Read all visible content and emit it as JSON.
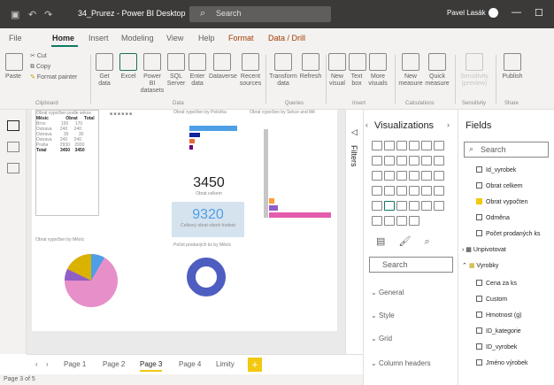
{
  "titlebar": {
    "title": "34_Prurez - Power BI Desktop",
    "search": "Search",
    "user": "Pavel Lasák"
  },
  "ribbon_tabs": [
    "File",
    "Home",
    "Insert",
    "Modeling",
    "View",
    "Help",
    "Format",
    "Data / Drill"
  ],
  "ribbon": {
    "clipboard": {
      "paste": "Paste",
      "cut": "Cut",
      "copy": "Copy",
      "format_painter": "Format painter",
      "label": "Clipboard"
    },
    "data": {
      "get_data": "Get data",
      "excel": "Excel",
      "power_bi": "Power BI datasets",
      "sql": "SQL Server",
      "enter": "Enter data",
      "dataverse": "Dataverse",
      "recent": "Recent sources",
      "label": "Data"
    },
    "queries": {
      "transform": "Transform data",
      "refresh": "Refresh",
      "label": "Queries"
    },
    "insert": {
      "new_visual": "New visual",
      "text_box": "Text box",
      "more_visuals": "More visuals",
      "label": "Insert"
    },
    "calculations": {
      "new_measure": "New measure",
      "quick_measure": "Quick measure",
      "label": "Calculations"
    },
    "sensitivity": {
      "sensitivity": "Sensitivity (preview)",
      "label": "Sensitivity"
    },
    "share": {
      "publish": "Publish",
      "label": "Share"
    }
  },
  "report": {
    "card1_value": "3450",
    "card1_label": "Obrat celkem",
    "card2_value": "9320",
    "card2_label": "Celkový obrat všech hodnot",
    "bar_title": "Obrat vypočten by Položka",
    "stack_title": "Obrat vypočten by Sekce and Mě",
    "pie_title": "Obrat vypočten by Měsíc",
    "donut_title": "Počet prodaných ks by Měsíc",
    "table_title": "Obrat vypočten podle sekce",
    "table_headers": [
      "Měsíc",
      "Obrat",
      "Total"
    ],
    "table_rows": [
      [
        "Brno",
        "150",
        "170"
      ],
      [
        "Ostrava",
        "240",
        "240"
      ],
      [
        "Ostrava",
        "30",
        "30"
      ],
      [
        "Ostrava",
        "240",
        "240"
      ],
      [
        "Praha",
        "2930",
        "2930"
      ],
      [
        "Total",
        "3450",
        "3450"
      ]
    ]
  },
  "filters_label": "Filters",
  "visualizations": {
    "title": "Visualizations",
    "search": "Search",
    "sections": [
      "General",
      "Style",
      "Grid",
      "Column headers"
    ]
  },
  "fields": {
    "title": "Fields",
    "search": "Search",
    "items": [
      {
        "label": "Id_vyrobek",
        "check": false
      },
      {
        "label": "Obrat celkem",
        "check": false
      },
      {
        "label": "Obrat vypočten",
        "check": true
      },
      {
        "label": "Odměna",
        "check": false
      },
      {
        "label": "Počet prodaných ks",
        "check": false
      },
      {
        "label": "Unpivotovat",
        "check": false
      },
      {
        "label": "Vyrobky",
        "check": false
      },
      {
        "label": "Cena za ks",
        "check": false
      },
      {
        "label": "Custom",
        "check": false
      },
      {
        "label": "Hmotnost (g)",
        "check": false
      },
      {
        "label": "ID_kategorie",
        "check": false
      },
      {
        "label": "ID_vyrobek",
        "check": false
      },
      {
        "label": "Jméno výrobek",
        "check": false
      }
    ]
  },
  "pages": [
    "Page 1",
    "Page 2",
    "Page 3",
    "Page 4",
    "Limity"
  ],
  "status": "Page 3 of 5"
}
